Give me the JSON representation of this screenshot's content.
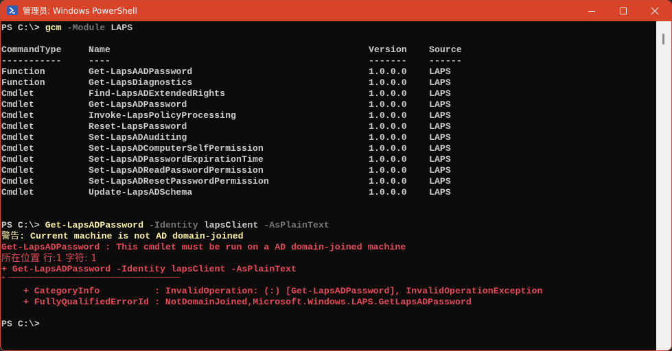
{
  "window": {
    "title": "管理员: Windows PowerShell",
    "accent_color": "#d9432a",
    "buttons": {
      "minimize": "minimize",
      "maximize": "maximize",
      "close": "close"
    }
  },
  "terminal": {
    "prompt": "PS C:\\> ",
    "command1": {
      "cmd": "gcm",
      "param": "-Module",
      "arg": "LAPS"
    },
    "table": {
      "headers": [
        "CommandType",
        "Name",
        "Version",
        "Source"
      ],
      "underlines": [
        "-----------",
        "----",
        "-------",
        "------"
      ],
      "rows": [
        [
          "Function",
          "Get-LapsAADPassword",
          "1.0.0.0",
          "LAPS"
        ],
        [
          "Function",
          "Get-LapsDiagnostics",
          "1.0.0.0",
          "LAPS"
        ],
        [
          "Cmdlet",
          "Find-LapsADExtendedRights",
          "1.0.0.0",
          "LAPS"
        ],
        [
          "Cmdlet",
          "Get-LapsADPassword",
          "1.0.0.0",
          "LAPS"
        ],
        [
          "Cmdlet",
          "Invoke-LapsPolicyProcessing",
          "1.0.0.0",
          "LAPS"
        ],
        [
          "Cmdlet",
          "Reset-LapsPassword",
          "1.0.0.0",
          "LAPS"
        ],
        [
          "Cmdlet",
          "Set-LapsADAuditing",
          "1.0.0.0",
          "LAPS"
        ],
        [
          "Cmdlet",
          "Set-LapsADComputerSelfPermission",
          "1.0.0.0",
          "LAPS"
        ],
        [
          "Cmdlet",
          "Set-LapsADPasswordExpirationTime",
          "1.0.0.0",
          "LAPS"
        ],
        [
          "Cmdlet",
          "Set-LapsADReadPasswordPermission",
          "1.0.0.0",
          "LAPS"
        ],
        [
          "Cmdlet",
          "Set-LapsADResetPasswordPermission",
          "1.0.0.0",
          "LAPS"
        ],
        [
          "Cmdlet",
          "Update-LapsADSchema",
          "1.0.0.0",
          "LAPS"
        ]
      ]
    },
    "command2": {
      "cmd": "Get-LapsADPassword",
      "param1": "-Identity",
      "arg1": "lapsClient",
      "param2": "-AsPlainText"
    },
    "warning": {
      "label": "警告",
      "text": ": Current machine is not AD domain-joined"
    },
    "error": {
      "message": "Get-LapsADPassword : This cmdlet must be run on a AD domain-joined machine",
      "location": "所在位置 行:1 字符: 1",
      "echo": "+ Get-LapsADPassword -Identity lapsClient -AsPlainText",
      "underline": "+ ~~~~~~~~~~~~~~~~~~~~~~~~~~~~~~~~~~~~~~~~~~~~~~~~~~~~",
      "category_info": "    + CategoryInfo          : InvalidOperation: (:) [Get-LapsADPassword], InvalidOperationException",
      "fqid": "    + FullyQualifiedErrorId : NotDomainJoined,Microsoft.Windows.LAPS.GetLapsADPassword"
    },
    "final_prompt": "PS C:\\>"
  },
  "colors": {
    "background": "#0c0c0c",
    "foreground": "#cccccc",
    "command": "#f9f1a5",
    "parameter": "#767676",
    "error": "#e74856",
    "warning": "#f9f1a5"
  }
}
